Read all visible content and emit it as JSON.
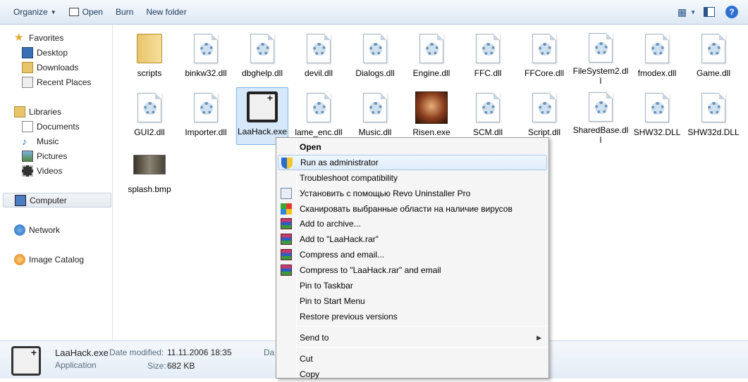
{
  "toolbar": {
    "organize": "Organize",
    "open": "Open",
    "burn": "Burn",
    "new_folder": "New folder"
  },
  "nav": {
    "favorites": "Favorites",
    "desktop": "Desktop",
    "downloads": "Downloads",
    "recent_places": "Recent Places",
    "libraries": "Libraries",
    "documents": "Documents",
    "music": "Music",
    "pictures": "Pictures",
    "videos": "Videos",
    "computer": "Computer",
    "network": "Network",
    "image_catalog": "Image Catalog"
  },
  "files": [
    {
      "name": "scripts",
      "type": "folder"
    },
    {
      "name": "binkw32.dll",
      "type": "dll"
    },
    {
      "name": "dbghelp.dll",
      "type": "dll"
    },
    {
      "name": "devil.dll",
      "type": "dll"
    },
    {
      "name": "Dialogs.dll",
      "type": "dll"
    },
    {
      "name": "Engine.dll",
      "type": "dll"
    },
    {
      "name": "FFC.dll",
      "type": "dll"
    },
    {
      "name": "FFCore.dll",
      "type": "dll"
    },
    {
      "name": "FileSystem2.dll",
      "type": "dll"
    },
    {
      "name": "fmodex.dll",
      "type": "dll"
    },
    {
      "name": "Game.dll",
      "type": "dll"
    },
    {
      "name": "GUI2.dll",
      "type": "dll"
    },
    {
      "name": "Importer.dll",
      "type": "dll"
    },
    {
      "name": "LaaHack.exe",
      "type": "exe-selected"
    },
    {
      "name": "lame_enc.dll",
      "type": "dll"
    },
    {
      "name": "Music.dll",
      "type": "dll"
    },
    {
      "name": "Risen.exe",
      "type": "exe-game"
    },
    {
      "name": "SCM.dll",
      "type": "dll"
    },
    {
      "name": "Script.dll",
      "type": "dll"
    },
    {
      "name": "SharedBase.dll",
      "type": "dll"
    },
    {
      "name": "SHW32.DLL",
      "type": "dll"
    },
    {
      "name": "SHW32d.DLL",
      "type": "dll"
    },
    {
      "name": "splash.bmp",
      "type": "image"
    }
  ],
  "file_labels": {
    "f0": "scripts",
    "f1": "binkw32.dll",
    "f2": "dbghelp.dll",
    "f3": "devil.dll",
    "f4": "Dialogs.dll",
    "f5": "Engine.dll",
    "f6": "FFC.dll",
    "f7": "FFCore.dll",
    "f8": "FileSystem2.dll",
    "f9": "fmodex.dll",
    "f10": "Game.dll",
    "f11": "GUI2.dll",
    "f12": "Importer.dll",
    "f13": "LaaHack.exe",
    "f14": "lame_enc.dll",
    "f15": "Music.dll",
    "f16": "Risen.exe",
    "f17": "SCM.dll",
    "f18": "Script.dll",
    "f19": "SharedBase.dll",
    "f20": "SHW32.DLL",
    "f21": "SHW32d.DLL",
    "f22": "splash.bmp"
  },
  "context_menu": {
    "open": "Open",
    "run_as_admin": "Run as administrator",
    "troubleshoot": "Troubleshoot compatibility",
    "revo": "Установить с помощью Revo Uninstaller Pro",
    "scan": "Сканировать выбранные области на наличие вирусов",
    "add_archive": "Add to archive...",
    "add_rar": "Add to \"LaaHack.rar\"",
    "compress_email": "Compress and email...",
    "compress_rar_email": "Compress to \"LaaHack.rar\" and email",
    "pin_taskbar": "Pin to Taskbar",
    "pin_start": "Pin to Start Menu",
    "restore": "Restore previous versions",
    "send_to": "Send to",
    "cut": "Cut",
    "copy": "Copy"
  },
  "details": {
    "name": "LaaHack.exe",
    "type": "Application",
    "date_modified_label": "Date modified:",
    "date_modified": "11.11.2006 18:35",
    "size_label": "Size:",
    "size": "682 KB",
    "date_created_fragment": "Da"
  }
}
